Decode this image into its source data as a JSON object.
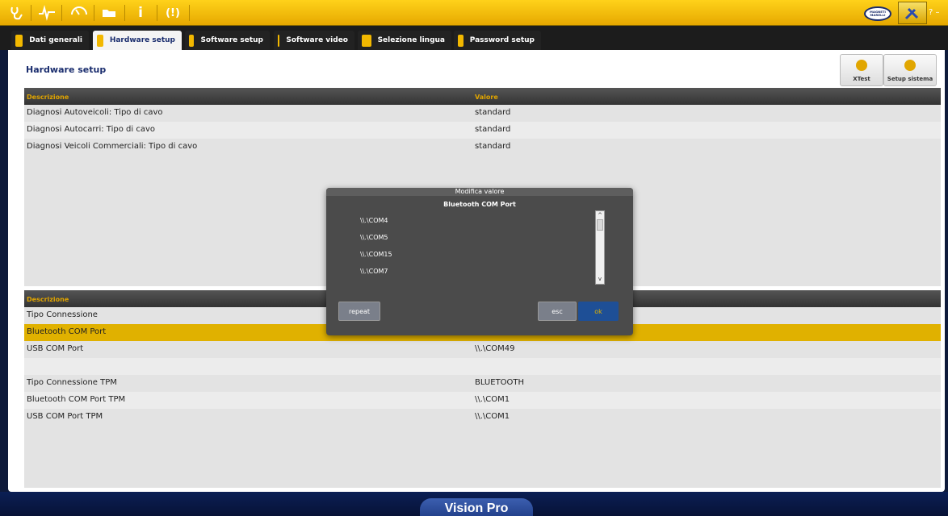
{
  "toolbar": {
    "icons": [
      "stethoscope-icon",
      "pulse-icon",
      "gauge-icon",
      "folder-icon",
      "info-icon",
      "warning-icon"
    ],
    "info_glyph": "i",
    "warning_glyph": "(!)",
    "brand_logo": "MAGNETI MARELLI",
    "help_glyph": "? –"
  },
  "tabs": [
    {
      "label": "Dati generali",
      "icon": "people-icon"
    },
    {
      "label": "Hardware setup",
      "icon": "gear-icon"
    },
    {
      "label": "Software setup",
      "icon": "document-icon"
    },
    {
      "label": "Software video",
      "icon": "monitor-icon"
    },
    {
      "label": "Selezione lingua",
      "icon": "flag-icon"
    },
    {
      "label": "Password setup",
      "icon": "key-icon"
    }
  ],
  "panel": {
    "title": "Hardware setup",
    "buttons": [
      {
        "label": "XTest",
        "icon": "xtest-icon"
      },
      {
        "label": "Setup sistema",
        "icon": "wrench-icon"
      }
    ]
  },
  "table1": {
    "headers": [
      "Descrizione",
      "Valore"
    ],
    "rows": [
      {
        "desc": "Diagnosi Autoveicoli: Tipo di cavo",
        "value": "standard"
      },
      {
        "desc": "Diagnosi Autocarri: Tipo di cavo",
        "value": "standard"
      },
      {
        "desc": "Diagnosi Veicoli Commerciali: Tipo di cavo",
        "value": "standard"
      }
    ]
  },
  "table2": {
    "headers": [
      "Descrizione",
      ""
    ],
    "rows": [
      {
        "desc": "Tipo Connessione",
        "value": ""
      },
      {
        "desc": "Bluetooth COM Port",
        "value": ""
      },
      {
        "desc": "USB COM Port",
        "value": "\\\\.\\COM49"
      },
      {
        "desc": "",
        "value": ""
      },
      {
        "desc": "Tipo Connessione TPM",
        "value": "BLUETOOTH"
      },
      {
        "desc": "Bluetooth COM Port TPM",
        "value": "\\\\.\\COM1"
      },
      {
        "desc": "USB COM Port TPM",
        "value": "\\\\.\\COM1"
      }
    ]
  },
  "modal": {
    "title": "Modifica valore",
    "subtitle": "Bluetooth COM Port",
    "options": [
      "\\\\.\\COM4",
      "\\\\.\\COM5",
      "\\\\.\\COM15",
      "\\\\.\\COM7"
    ],
    "repeat_label": "repeat",
    "esc_label": "esc",
    "ok_label": "ok"
  },
  "footer": {
    "product": "Vision Pro"
  },
  "colors": {
    "accent": "#e0b100",
    "brand": "#1a2d6e"
  }
}
